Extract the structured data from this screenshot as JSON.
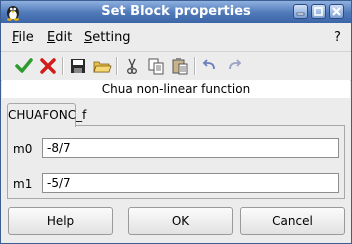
{
  "window": {
    "title": "Set Block properties",
    "controls": [
      "minimize-icon",
      "maximize-icon",
      "close-icon"
    ]
  },
  "menubar": {
    "file": "File",
    "edit": "Edit",
    "setting": "Setting",
    "help": "?"
  },
  "toolbar": {
    "icons": [
      "ok-check-icon",
      "cancel-x-icon",
      "save-icon",
      "open-folder-icon",
      "cut-icon",
      "copy-icon",
      "paste-icon",
      "undo-icon",
      "redo-icon"
    ]
  },
  "block": {
    "title": "Chua non-linear function",
    "tab_label": "CHUAFONC_f"
  },
  "params": {
    "m0": {
      "label": "m0",
      "value": "-8/7"
    },
    "m1": {
      "label": "m1",
      "value": "-5/7"
    }
  },
  "buttons": {
    "help": "Help",
    "ok": "OK",
    "cancel": "Cancel"
  },
  "colors": {
    "titlebar": "#4f78b8",
    "check_green": "#2f9a2f",
    "cross_red": "#d21b1b"
  }
}
